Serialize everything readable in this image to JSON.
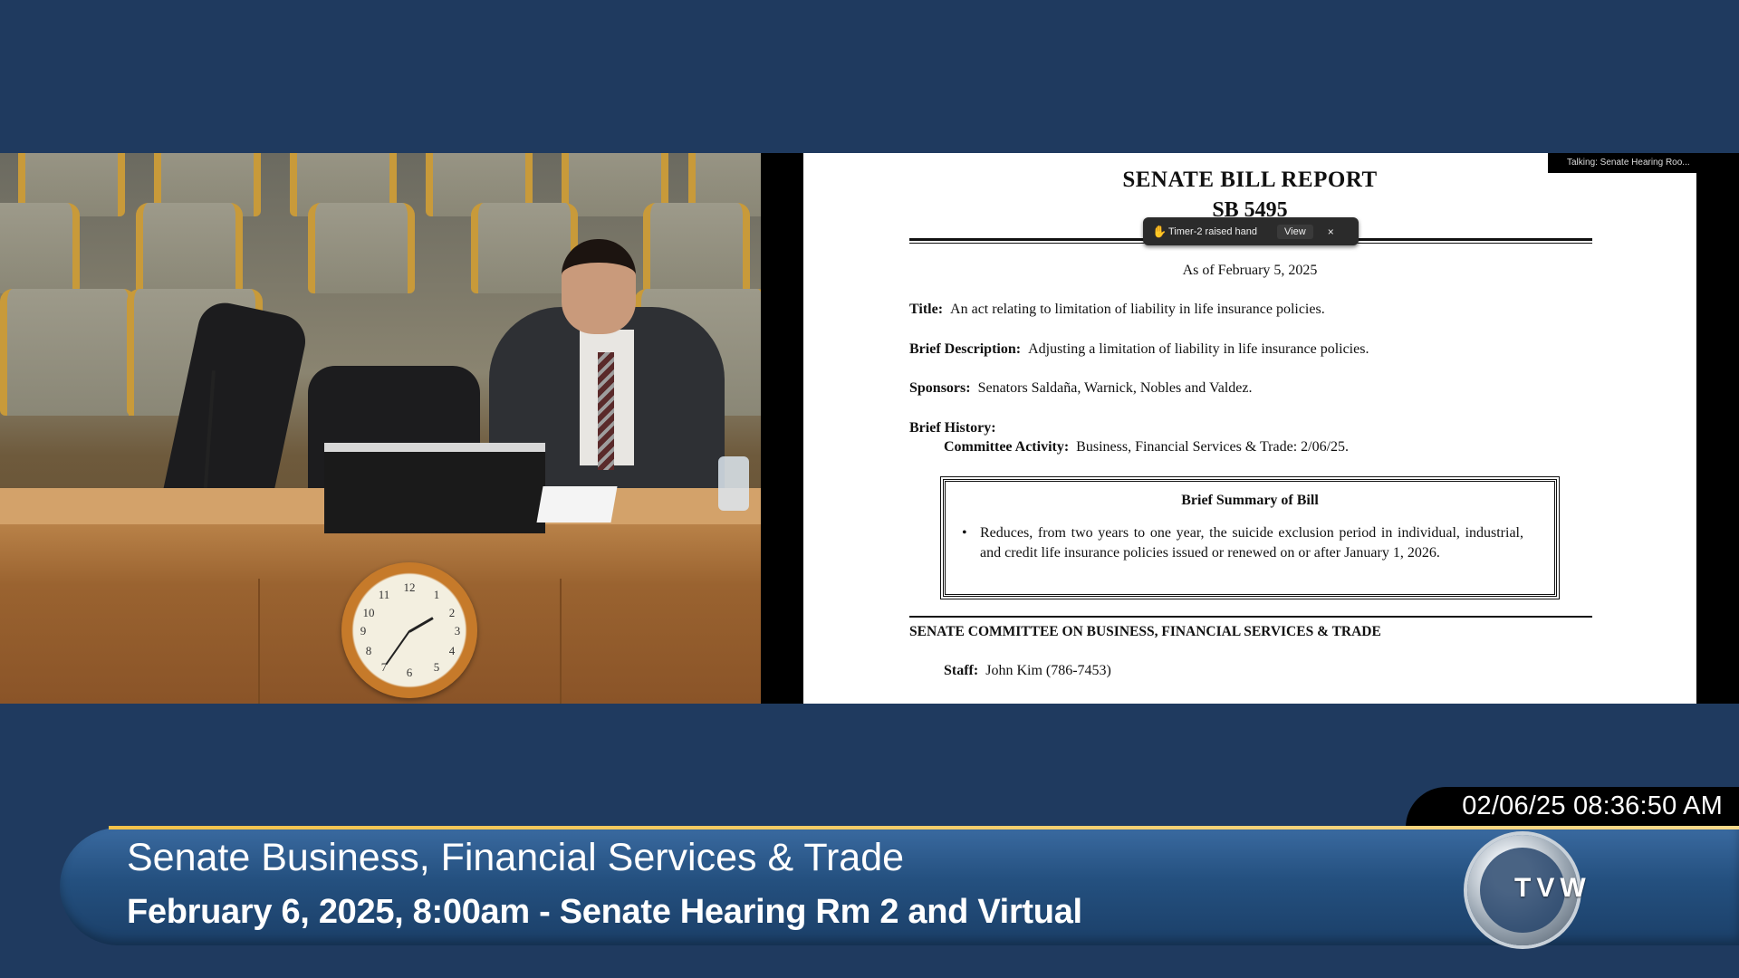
{
  "document": {
    "title": "SENATE BILL REPORT",
    "bill_number": "SB 5495",
    "as_of": "As of February 5, 2025",
    "title_label": "Title:",
    "title_text": "An act relating to limitation of liability in life insurance policies.",
    "brief_description_label": "Brief Description:",
    "brief_description_text": "Adjusting a limitation of liability in life insurance policies.",
    "sponsors_label": "Sponsors:",
    "sponsors_text": "Senators Saldaña, Warnick, Nobles and Valdez.",
    "brief_history_label": "Brief History:",
    "committee_activity_label": "Committee Activity:",
    "committee_activity_text": "Business, Financial Services & Trade: 2/06/25.",
    "summary_title": "Brief Summary of Bill",
    "summary_bullet": "Reduces, from two years to one year, the suicide exclusion period in individual, industrial, and credit life insurance policies issued or renewed on or after January 1, 2026.",
    "committee_heading": "SENATE COMMITTEE ON BUSINESS, FINANCIAL SERVICES & TRADE",
    "staff_label": "Staff:",
    "staff_text": "John Kim (786-7453)"
  },
  "talking_indicator": "Talking: Senate Hearing Roo...",
  "raise_hand_toast": {
    "message": "Timer-2 raised hand",
    "view_label": "View",
    "close_label": "×"
  },
  "timestamp": "02/06/25 08:36:50 AM",
  "lower_third": {
    "title": "Senate Business, Financial Services & Trade",
    "subtitle": "February 6, 2025, 8:00am - Senate Hearing Rm 2 and Virtual"
  },
  "logo_text": "TVW",
  "colors": {
    "background": "#1f3a5f",
    "lower_third": "#24507f",
    "accent_gold": "#f3c24a"
  }
}
